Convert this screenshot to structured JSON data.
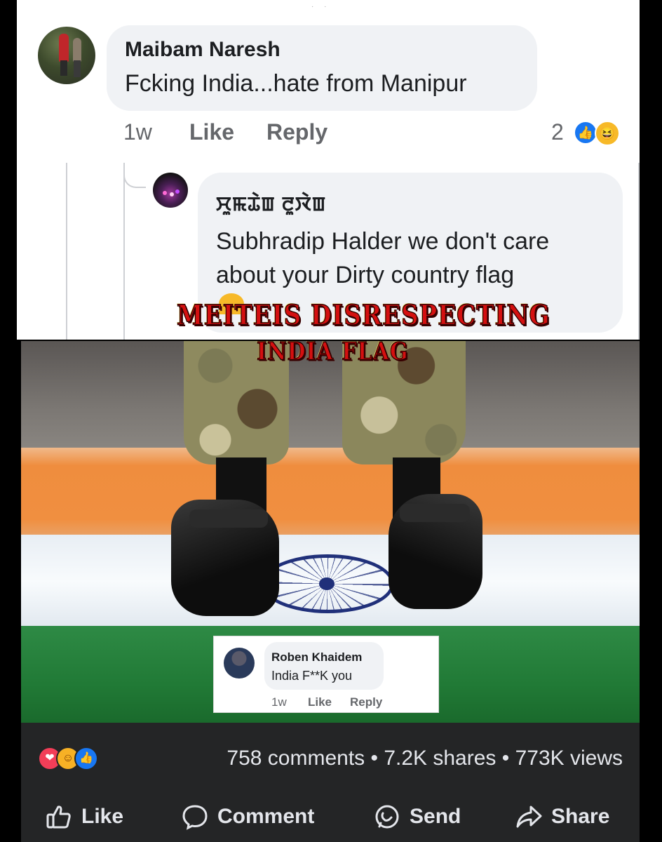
{
  "main_comment": {
    "author": "Maibam Naresh",
    "text": "Fcking India...hate from Manipur",
    "time": "1w",
    "like_label": "Like",
    "reply_label": "Reply",
    "reaction_count": "2"
  },
  "reply_comment": {
    "author": "ꯆꯨꯃꯊꯥꯡ ꯂꯨꯋꯥꯡ",
    "text": "Subhradip Halder we don't care about your Dirty country flag"
  },
  "overlay_caption": {
    "line1": "MEITEIS DISRESPECTING",
    "line2": "INDIA FLAG"
  },
  "inset_comment": {
    "author": "Roben Khaidem",
    "text": "India F**K you",
    "time": "1w",
    "like_label": "Like",
    "reply_label": "Reply"
  },
  "stats": {
    "text": "758 comments • 7.2K shares • 773K views"
  },
  "footer": {
    "like_label": "Like",
    "comment_label": "Comment",
    "send_label": "Send",
    "share_label": "Share"
  },
  "colors": {
    "bubble": "#f0f2f5",
    "dark_bar": "#242526",
    "brand_blue": "#1877f2",
    "caption_red": "#d41010"
  }
}
